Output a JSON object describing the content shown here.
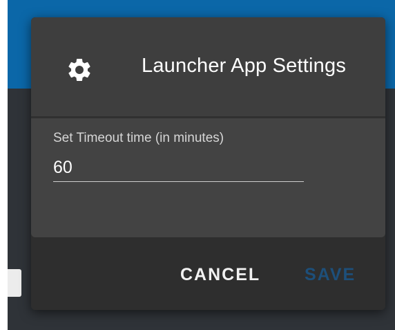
{
  "colors": {
    "app_header_blue": "#0b67a8",
    "app_body_dark": "#2f3338",
    "dialog_surface": "#434343",
    "dialog_actions_bg": "#2e2e2e",
    "save_disabled_blue": "#1d4f7a"
  },
  "dialog": {
    "icon": "gear-icon",
    "title": "Launcher App Settings",
    "timeout_field": {
      "label": "Set Timeout time (in minutes)",
      "value": "60"
    },
    "actions": {
      "cancel_label": "CANCEL",
      "save_label": "SAVE"
    }
  }
}
